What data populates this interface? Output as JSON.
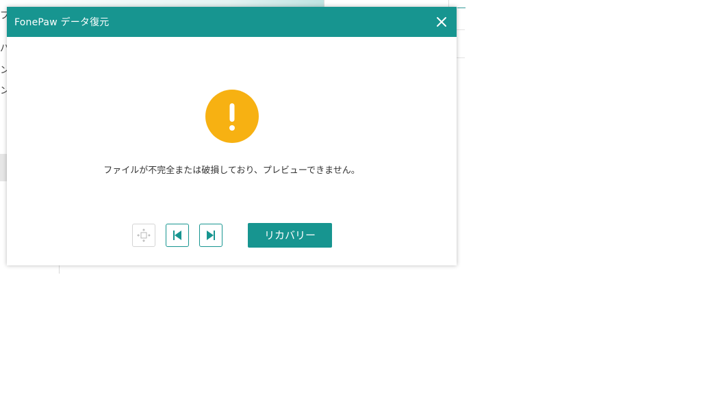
{
  "background_app": {
    "left_column_glyphs": [
      "プ",
      "パ",
      "ン",
      "ン"
    ]
  },
  "dialog": {
    "title": "FonePaw データ復元",
    "message": "ファイルが不完全または破損しており、プレビューできません。",
    "warning_symbol": "!",
    "buttons": {
      "recover_label": "リカバリー"
    },
    "icons": {
      "close": "close-icon",
      "warning": "exclamation-icon",
      "fit": "fit-to-window-icon",
      "previous": "skip-previous-icon",
      "next": "skip-next-icon"
    }
  },
  "colors": {
    "accent": "#179590",
    "warning": "#f7b112",
    "message_text": "#333333",
    "disabled_border": "#d4d4d4"
  }
}
